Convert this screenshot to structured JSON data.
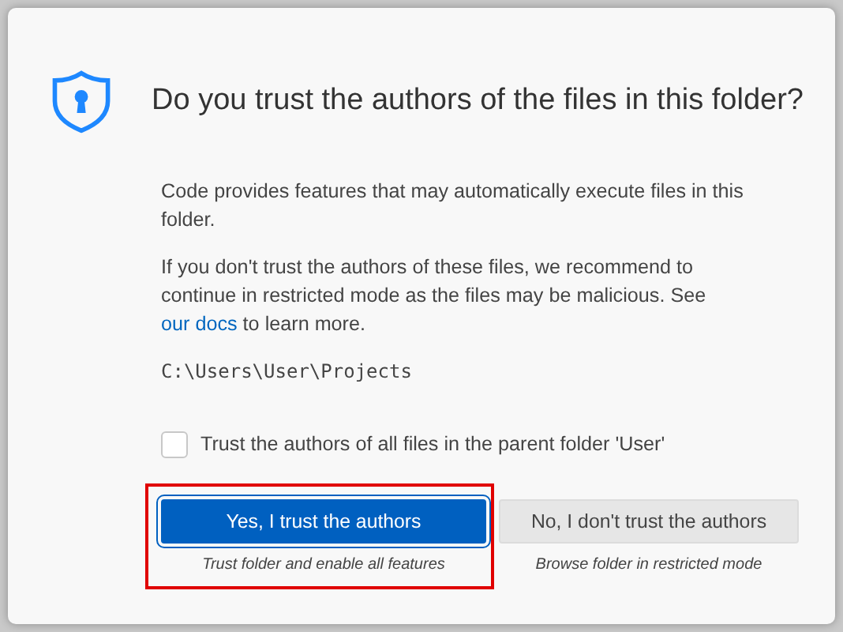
{
  "dialog": {
    "title": "Do you trust the authors of the files in this folder?",
    "paragraphs": [
      {
        "text": "Code provides features that may automatically execute files in this folder."
      },
      {
        "text": "If you don't trust the authors of these files, we recommend to continue in restricted mode as the files may be malicious. See ",
        "link": "our docs",
        "after": " to learn more."
      }
    ],
    "path": "C:\\Users\\User\\Projects",
    "checkbox": {
      "label": "Trust the authors of all files in the parent folder 'User'",
      "checked": false
    },
    "choices": [
      {
        "label": "Yes, I trust the authors",
        "caption": "Trust folder and enable all features",
        "kind": "primary",
        "highlighted": true
      },
      {
        "label": "No, I don't trust the authors",
        "caption": "Browse folder in restricted mode",
        "kind": "secondary",
        "highlighted": false
      }
    ]
  }
}
